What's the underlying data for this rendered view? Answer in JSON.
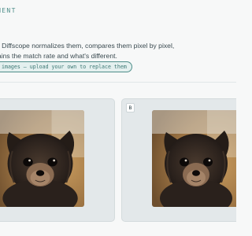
{
  "header": {
    "eyebrow": "MENT"
  },
  "intro": {
    "line1": "d Diffscope normalizes them, compares them pixel by pixel,",
    "line2": "lains the match rate and what's different."
  },
  "sample_notice": {
    "label": " images — upload your own to replace them"
  },
  "panels": [
    {
      "badge": "",
      "image_alt": "Long-haired chihuahua puppy photo"
    },
    {
      "badge": "B",
      "image_alt": "Long-haired chihuahua puppy photo"
    }
  ],
  "colors": {
    "accent": "#4e8e8a",
    "panel_bg": "#e3e8ea",
    "page_bg": "#f7f8f8"
  }
}
